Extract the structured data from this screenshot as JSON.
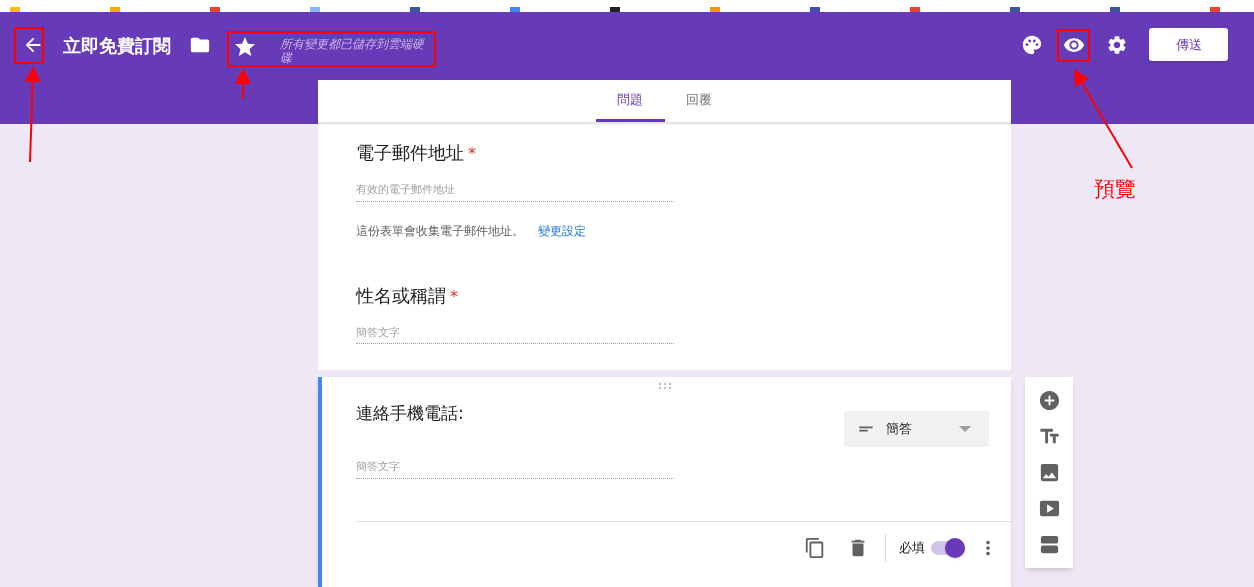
{
  "header": {
    "title": "立即免費訂閱",
    "save_status": "所有變更都已儲存到雲端硬碟",
    "send_button": "傳送"
  },
  "tabs": [
    {
      "label": "問題",
      "selected": true
    },
    {
      "label": "回覆",
      "selected": false
    }
  ],
  "questions": [
    {
      "kind": "email",
      "title": "電子郵件地址",
      "required_mark": "*",
      "placeholder": "有效的電子郵件地址",
      "note": "這份表單會收集電子郵件地址。",
      "note_link": "變更設定"
    },
    {
      "kind": "text",
      "title": "性名或稱謂",
      "required_mark": "*",
      "placeholder": "簡答文字"
    }
  ],
  "active_question": {
    "title": "連絡手機電話:",
    "placeholder": "簡答文字",
    "type_label": "簡答",
    "required_label": "必填",
    "required": true
  },
  "annotation": {
    "label": "預覽"
  }
}
